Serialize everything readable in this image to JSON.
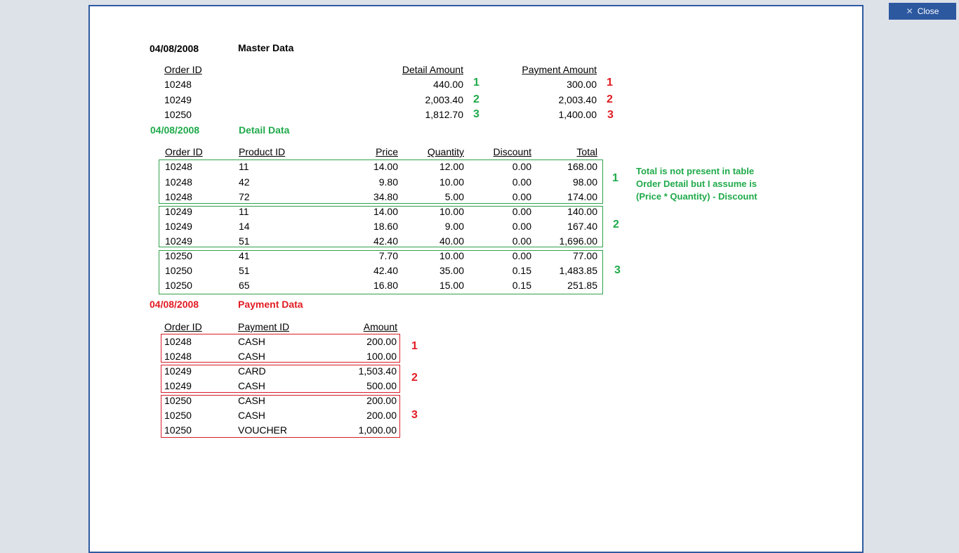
{
  "toolbar": {
    "close_label": "Close",
    "close_icon": "close-x-icon"
  },
  "master": {
    "date": "04/08/2008",
    "title": "Master Data",
    "headers": [
      "Order ID",
      "Detail Amount",
      "Payment Amount"
    ],
    "rows": [
      {
        "order_id": "10248",
        "detail_amount": "440.00",
        "payment_amount": "300.00",
        "group": "1"
      },
      {
        "order_id": "10249",
        "detail_amount": "2,003.40",
        "payment_amount": "2,003.40",
        "group": "2"
      },
      {
        "order_id": "10250",
        "detail_amount": "1,812.70",
        "payment_amount": "1,400.00",
        "group": "3"
      }
    ]
  },
  "detail": {
    "date": "04/08/2008",
    "title": "Detail Data",
    "headers": [
      "Order ID",
      "Product ID",
      "Price",
      "Quantity",
      "Discount",
      "Total"
    ],
    "rows": [
      [
        "10248",
        "11",
        "14.00",
        "12.00",
        "0.00",
        "168.00"
      ],
      [
        "10248",
        "42",
        "9.80",
        "10.00",
        "0.00",
        "98.00"
      ],
      [
        "10248",
        "72",
        "34.80",
        "5.00",
        "0.00",
        "174.00"
      ],
      [
        "10249",
        "11",
        "14.00",
        "10.00",
        "0.00",
        "140.00"
      ],
      [
        "10249",
        "14",
        "18.60",
        "9.00",
        "0.00",
        "167.40"
      ],
      [
        "10249",
        "51",
        "42.40",
        "40.00",
        "0.00",
        "1,696.00"
      ],
      [
        "10250",
        "41",
        "7.70",
        "10.00",
        "0.00",
        "77.00"
      ],
      [
        "10250",
        "51",
        "42.40",
        "35.00",
        "0.15",
        "1,483.85"
      ],
      [
        "10250",
        "65",
        "16.80",
        "15.00",
        "0.15",
        "251.85"
      ]
    ],
    "groups": [
      "1",
      "2",
      "3"
    ],
    "note": [
      "Total is not present in table",
      "Order Detail but I assume is",
      "(Price * Quantity) - Discount"
    ]
  },
  "payment": {
    "date": "04/08/2008",
    "title": "Payment Data",
    "headers": [
      "Order ID",
      "Payment ID",
      "Amount"
    ],
    "rows": [
      [
        "10248",
        "CASH",
        "200.00"
      ],
      [
        "10248",
        "CASH",
        "100.00"
      ],
      [
        "10249",
        "CARD",
        "1,503.40"
      ],
      [
        "10249",
        "CASH",
        "500.00"
      ],
      [
        "10250",
        "CASH",
        "200.00"
      ],
      [
        "10250",
        "CASH",
        "200.00"
      ],
      [
        "10250",
        "VOUCHER",
        "1,000.00"
      ]
    ],
    "groups": [
      "1",
      "2",
      "3"
    ]
  },
  "colors": {
    "green": "#1faa4a",
    "red": "#e21b23",
    "accent": "#2c58a0"
  }
}
